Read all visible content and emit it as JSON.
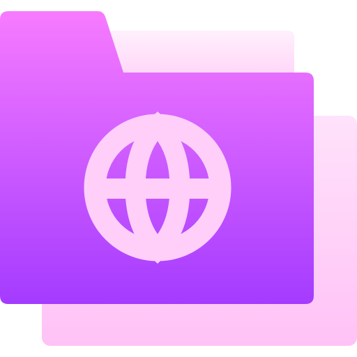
{
  "icon": {
    "name": "web-folder-icon",
    "symbol": "globe-icon",
    "colors": {
      "folder_gradient_top": "#F77BFF",
      "folder_gradient_bottom": "#A43BFF",
      "back_page_top": "#FFF0FC",
      "back_page_bottom": "#FFD0F7",
      "back_card_top": "#FFE2FB",
      "back_card_bottom": "#FFC2F6",
      "globe": "#FFCFF9"
    }
  }
}
